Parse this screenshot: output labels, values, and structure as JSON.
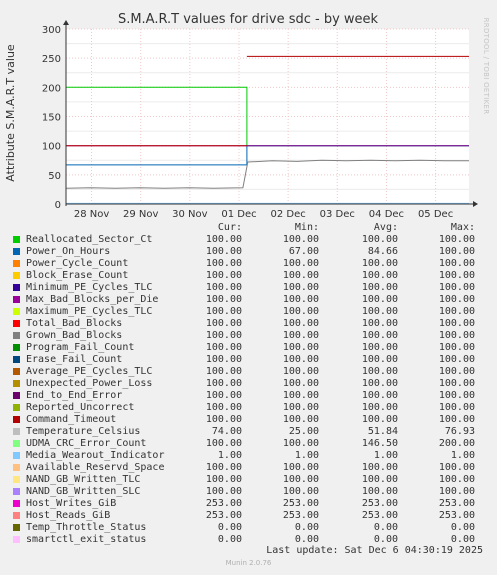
{
  "chart_data": {
    "type": "line",
    "title": "S.M.A.R.T values for drive sdc - by week",
    "ylabel": "Attribute S.M.A.R.T value",
    "ylim": [
      0,
      300
    ],
    "yticks": [
      0,
      50,
      100,
      150,
      200,
      250,
      300
    ],
    "xlim_days": [
      0,
      8.2
    ],
    "xticks": [
      {
        "label": "28 Nov",
        "day": 0.52
      },
      {
        "label": "29 Nov",
        "day": 1.52
      },
      {
        "label": "30 Nov",
        "day": 2.52
      },
      {
        "label": "01 Dec",
        "day": 3.52
      },
      {
        "label": "02 Dec",
        "day": 4.52
      },
      {
        "label": "03 Dec",
        "day": 5.52
      },
      {
        "label": "04 Dec",
        "day": 6.52
      },
      {
        "label": "05 Dec",
        "day": 7.52
      }
    ],
    "grid": true,
    "columns": [
      "Cur:",
      "Min:",
      "Avg:",
      "Max:"
    ],
    "series": [
      {
        "name": "Reallocated_Sector_Ct",
        "color": "#00cc00",
        "cur": "100.00",
        "min": "100.00",
        "avg": "100.00",
        "max": "100.00"
      },
      {
        "name": "Power_On_Hours",
        "color": "#0066b3",
        "cur": "100.00",
        "min": "67.00",
        "avg": "84.66",
        "max": "100.00"
      },
      {
        "name": "Power_Cycle_Count",
        "color": "#ff8000",
        "cur": "100.00",
        "min": "100.00",
        "avg": "100.00",
        "max": "100.00"
      },
      {
        "name": "Block_Erase_Count",
        "color": "#ffcc00",
        "cur": "100.00",
        "min": "100.00",
        "avg": "100.00",
        "max": "100.00"
      },
      {
        "name": "Minimum_PE_Cycles_TLC",
        "color": "#330099",
        "cur": "100.00",
        "min": "100.00",
        "avg": "100.00",
        "max": "100.00"
      },
      {
        "name": "Max_Bad_Blocks_per_Die",
        "color": "#990099",
        "cur": "100.00",
        "min": "100.00",
        "avg": "100.00",
        "max": "100.00"
      },
      {
        "name": "Maximum_PE_Cycles_TLC",
        "color": "#ccff00",
        "cur": "100.00",
        "min": "100.00",
        "avg": "100.00",
        "max": "100.00"
      },
      {
        "name": "Total_Bad_Blocks",
        "color": "#ff0000",
        "cur": "100.00",
        "min": "100.00",
        "avg": "100.00",
        "max": "100.00"
      },
      {
        "name": "Grown_Bad_Blocks",
        "color": "#808080",
        "cur": "100.00",
        "min": "100.00",
        "avg": "100.00",
        "max": "100.00"
      },
      {
        "name": "Program_Fail_Count",
        "color": "#008f00",
        "cur": "100.00",
        "min": "100.00",
        "avg": "100.00",
        "max": "100.00"
      },
      {
        "name": "Erase_Fail_Count",
        "color": "#00487d",
        "cur": "100.00",
        "min": "100.00",
        "avg": "100.00",
        "max": "100.00"
      },
      {
        "name": "Average_PE_Cycles_TLC",
        "color": "#b35a00",
        "cur": "100.00",
        "min": "100.00",
        "avg": "100.00",
        "max": "100.00"
      },
      {
        "name": "Unexpected_Power_Loss",
        "color": "#b38f00",
        "cur": "100.00",
        "min": "100.00",
        "avg": "100.00",
        "max": "100.00"
      },
      {
        "name": "End_to_End_Error",
        "color": "#6b006b",
        "cur": "100.00",
        "min": "100.00",
        "avg": "100.00",
        "max": "100.00"
      },
      {
        "name": "Reported_Uncorrect",
        "color": "#8fb300",
        "cur": "100.00",
        "min": "100.00",
        "avg": "100.00",
        "max": "100.00"
      },
      {
        "name": "Command_Timeout",
        "color": "#b30000",
        "cur": "100.00",
        "min": "100.00",
        "avg": "100.00",
        "max": "100.00"
      },
      {
        "name": "Temperature_Celsius",
        "color": "#bebebe",
        "cur": "74.00",
        "min": "25.00",
        "avg": "51.84",
        "max": "76.93"
      },
      {
        "name": "UDMA_CRC_Error_Count",
        "color": "#80ff80",
        "cur": "100.00",
        "min": "100.00",
        "avg": "146.50",
        "max": "200.00"
      },
      {
        "name": "Media_Wearout_Indicator",
        "color": "#80c9ff",
        "cur": "1.00",
        "min": "1.00",
        "avg": "1.00",
        "max": "1.00"
      },
      {
        "name": "Available_Reservd_Space",
        "color": "#ffc080",
        "cur": "100.00",
        "min": "100.00",
        "avg": "100.00",
        "max": "100.00"
      },
      {
        "name": "NAND_GB_Written_TLC",
        "color": "#ffe680",
        "cur": "100.00",
        "min": "100.00",
        "avg": "100.00",
        "max": "100.00"
      },
      {
        "name": "NAND_GB_Written_SLC",
        "color": "#aa80ff",
        "cur": "100.00",
        "min": "100.00",
        "avg": "100.00",
        "max": "100.00"
      },
      {
        "name": "Host_Writes_GiB",
        "color": "#ee00cc",
        "cur": "253.00",
        "min": "253.00",
        "avg": "253.00",
        "max": "253.00"
      },
      {
        "name": "Host_Reads_GiB",
        "color": "#ff8080",
        "cur": "253.00",
        "min": "253.00",
        "avg": "253.00",
        "max": "253.00"
      },
      {
        "name": "Temp_Throttle_Status",
        "color": "#666600",
        "cur": "0.00",
        "min": "0.00",
        "avg": "0.00",
        "max": "0.00"
      },
      {
        "name": "smartctl_exit_status",
        "color": "#ffbfff",
        "cur": "0.00",
        "min": "0.00",
        "avg": "0.00",
        "max": "0.00"
      }
    ],
    "lines": [
      {
        "series": "UDMA_CRC_Error_Count",
        "color": "#00cc00",
        "points": [
          [
            0,
            200
          ],
          [
            3.68,
            200
          ],
          [
            3.68,
            100
          ],
          [
            8.2,
            100
          ]
        ]
      },
      {
        "series": "Power_On_Hours",
        "color": "#0066b3",
        "points": [
          [
            0,
            67
          ],
          [
            3.68,
            67
          ],
          [
            3.68,
            100
          ],
          [
            8.2,
            100
          ]
        ]
      },
      {
        "series": "Max_Bad_Blocks_per_Die",
        "color": "#990099",
        "points": [
          [
            0,
            100
          ],
          [
            8.2,
            100
          ]
        ]
      },
      {
        "series": "Command_Timeout",
        "color": "#b30000",
        "points": [
          [
            0,
            100
          ],
          [
            3.68,
            100
          ]
        ]
      },
      {
        "series": "Host_Writes_GiB",
        "color": "#b30000",
        "points": [
          [
            3.68,
            253
          ],
          [
            8.2,
            253
          ]
        ]
      },
      {
        "series": "Temperature_Celsius",
        "color": "#808080",
        "points": [
          [
            0,
            27
          ],
          [
            0.5,
            28
          ],
          [
            1.0,
            27
          ],
          [
            1.5,
            28
          ],
          [
            2.0,
            27
          ],
          [
            2.5,
            28
          ],
          [
            3.0,
            27
          ],
          [
            3.6,
            28
          ],
          [
            3.7,
            72
          ],
          [
            4.2,
            74
          ],
          [
            4.7,
            73
          ],
          [
            5.2,
            75
          ],
          [
            5.7,
            74
          ],
          [
            6.2,
            75
          ],
          [
            6.7,
            74
          ],
          [
            7.2,
            75
          ],
          [
            7.7,
            74
          ],
          [
            8.2,
            74
          ]
        ]
      },
      {
        "series": "Media_Wearout_Indicator",
        "color": "#80c9ff",
        "points": [
          [
            0,
            1
          ],
          [
            8.2,
            1
          ]
        ]
      }
    ]
  },
  "side_text": "RRDTOOL / TOBI OETIKER",
  "footer": {
    "last_update": "Last update: Sat Dec  6 04:30:19 2025",
    "munin": "Munin 2.0.76"
  }
}
